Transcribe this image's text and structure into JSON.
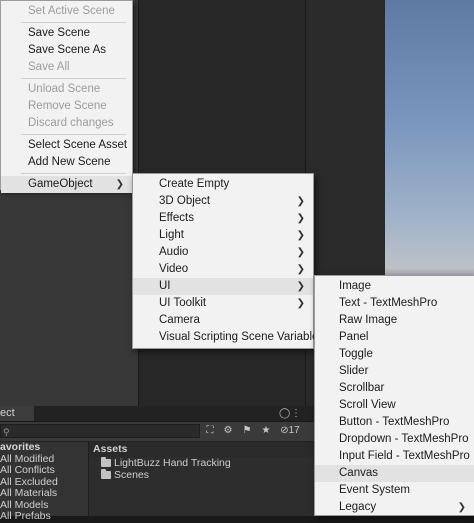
{
  "scene_menu": {
    "items": [
      {
        "label": "Set Active Scene",
        "disabled": true
      },
      {
        "sep": true
      },
      {
        "label": "Save Scene",
        "disabled": false
      },
      {
        "label": "Save Scene As",
        "disabled": false
      },
      {
        "label": "Save All",
        "disabled": true
      },
      {
        "sep": true
      },
      {
        "label": "Unload Scene",
        "disabled": true
      },
      {
        "label": "Remove Scene",
        "disabled": true
      },
      {
        "label": "Discard changes",
        "disabled": true
      },
      {
        "sep": true
      },
      {
        "label": "Select Scene Asset",
        "disabled": false
      },
      {
        "label": "Add New Scene",
        "disabled": false
      },
      {
        "sep": true
      },
      {
        "label": "GameObject",
        "submenu": true,
        "highlighted": true
      }
    ]
  },
  "gameobject_menu": {
    "items": [
      {
        "label": "Create Empty"
      },
      {
        "label": "3D Object",
        "submenu": true
      },
      {
        "label": "Effects",
        "submenu": true
      },
      {
        "label": "Light",
        "submenu": true
      },
      {
        "label": "Audio",
        "submenu": true
      },
      {
        "label": "Video",
        "submenu": true
      },
      {
        "label": "UI",
        "submenu": true,
        "highlighted": true
      },
      {
        "label": "UI Toolkit",
        "submenu": true
      },
      {
        "label": "Camera"
      },
      {
        "label": "Visual Scripting Scene Variables"
      }
    ]
  },
  "ui_menu": {
    "items": [
      {
        "label": "Image"
      },
      {
        "label": "Text - TextMeshPro"
      },
      {
        "label": "Raw Image"
      },
      {
        "label": "Panel"
      },
      {
        "label": "Toggle"
      },
      {
        "label": "Slider"
      },
      {
        "label": "Scrollbar"
      },
      {
        "label": "Scroll View"
      },
      {
        "label": "Button - TextMeshPro"
      },
      {
        "label": "Dropdown - TextMeshPro"
      },
      {
        "label": "Input Field - TextMeshPro"
      },
      {
        "label": "Canvas",
        "highlighted": true
      },
      {
        "label": "Event System"
      },
      {
        "label": "Legacy",
        "submenu": true
      }
    ]
  },
  "project_panel": {
    "tab_label": "ect",
    "hidden_count": "17",
    "favorites": [
      "avorites",
      "All Modified",
      "All Conflicts",
      "All Excluded",
      "All Materials",
      "All Models",
      "All Prefabs"
    ],
    "assets_header": "Assets",
    "folders": [
      "LightBuzz Hand Tracking",
      "Scenes"
    ]
  },
  "icons": {
    "submenu": "chevron-right-icon",
    "search": "search-icon",
    "folder": "folder-icon"
  }
}
